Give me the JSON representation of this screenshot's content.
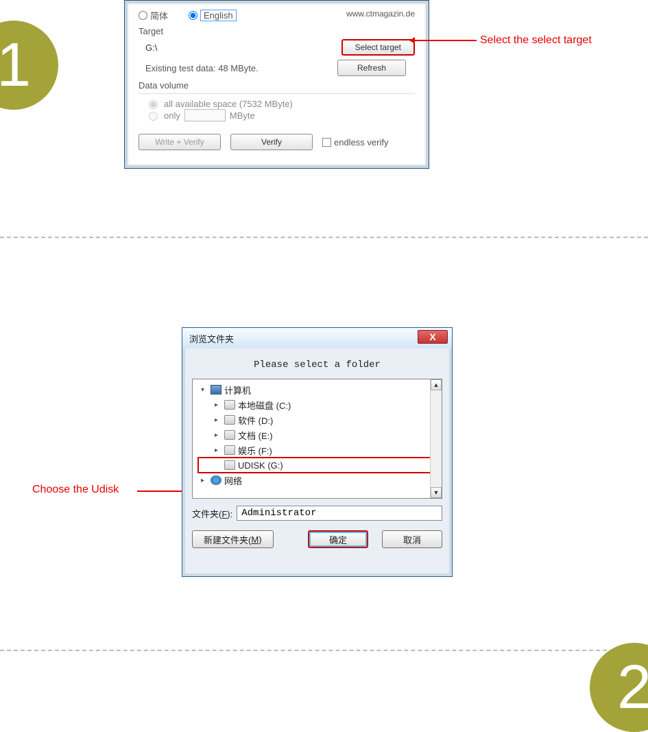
{
  "steps": {
    "one": "1",
    "two": "2"
  },
  "annot1": "Select the select target",
  "annot2": "Choose the Udisk",
  "win1": {
    "lang_cn": "简体",
    "lang_en": "English",
    "url": "www.ctmagazin.de",
    "target_label": "Target",
    "target_value": "G:\\",
    "select_btn": "Select target",
    "existing": "Existing test data: 48 MByte.",
    "refresh_btn": "Refresh",
    "dv_label": "Data volume",
    "dv_all": "all available space (7532 MByte)",
    "dv_only": "only",
    "dv_unit": "MByte",
    "write_btn": "Write + Verify",
    "verify_btn": "Verify",
    "endless": "endless verify"
  },
  "win2": {
    "title": "浏览文件夹",
    "prompt": "Please select a folder",
    "tree": {
      "root": "计算机",
      "c": "本地磁盘 (C:)",
      "d": "软件 (D:)",
      "e": "文档 (E:)",
      "f": "娱乐 (F:)",
      "g": "UDISK (G:)",
      "net": "网络"
    },
    "folder_lbl_a": "文件夹(",
    "folder_lbl_u": "F",
    "folder_lbl_b": "):",
    "folder_val": "Administrator",
    "new_btn_a": "新建文件夹(",
    "new_btn_u": "M",
    "new_btn_b": ")",
    "ok_btn": "确定",
    "cancel_btn": "取消"
  }
}
